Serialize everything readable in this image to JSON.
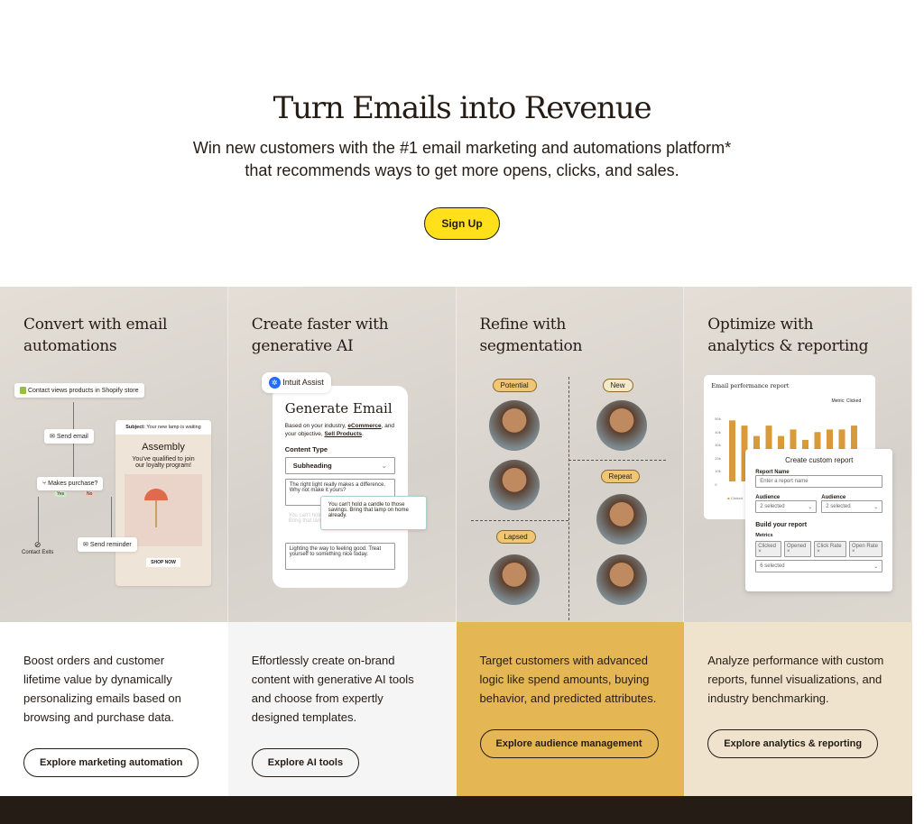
{
  "hero": {
    "title": "Turn Emails into Revenue",
    "subtitle_line1": "Win new customers with the #1 email marketing and automations platform*",
    "subtitle_line2": "that recommends ways to get more opens, clicks, and sales.",
    "cta": "Sign Up"
  },
  "features": [
    {
      "title_line1": "Convert with email",
      "title_line2": "automations",
      "description": "Boost orders and customer lifetime value by dynamically personalizing emails based on browsing and purchase data.",
      "button": "Explore marketing automation",
      "bg": "#ffffff",
      "illustration": {
        "trigger": "Contact views products in Shopify store",
        "send_email": "Send email",
        "decision": "Makes purchase?",
        "yes": "Yes",
        "no": "No",
        "exit": "Contact Exits",
        "reminder": "Send reminder",
        "subject_label": "Subject:",
        "subject": "Your new lamp is waiting",
        "brand": "Assembly",
        "message": "You've qualified to join our loyalty program!",
        "shop": "SHOP NOW"
      }
    },
    {
      "title_line1": "Create faster with",
      "title_line2": "generative AI",
      "description": "Effortlessly create on-brand content with generative AI tools and choose from expertly designed templates.",
      "button": "Explore AI tools",
      "bg": "#f5f5f5",
      "illustration": {
        "badge": "Intuit Assist",
        "heading": "Generate Email",
        "intro_a": "Based on your industry, ",
        "industry": "eCommerce",
        "intro_b": ", and your objective, ",
        "objective": "Sell Products",
        "content_type_label": "Content Type",
        "content_type": "Subheading",
        "option1": "The right light really makes a difference. Why not make it yours?",
        "option2": "You can't hold a candle to those savings. Bring that lamp on home already.",
        "option3": "Lighting the way to feeling good. Treat yourself to something nice today."
      }
    },
    {
      "title_line1": "Refine with",
      "title_line2": "segmentation",
      "description": "Target customers with advanced logic like spend amounts, buying behavior, and predicted attributes.",
      "button": "Explore audience management",
      "bg": "#e5b654",
      "illustration": {
        "segments": [
          "Potential",
          "New",
          "Repeat",
          "Lapsed"
        ]
      }
    },
    {
      "title_line1": "Optimize with",
      "title_line2": "analytics & reporting",
      "description": "Analyze performance with custom reports, funnel visualizations, and industry benchmarking.",
      "button": "Explore analytics & reporting",
      "bg": "#efe3cd",
      "illustration": {
        "report_title": "Email performance report",
        "metric_select": "Metric: Clicked",
        "legend": "Clicked",
        "y_ticks": [
          "50k",
          "40k",
          "30k",
          "20k",
          "10k",
          "0"
        ],
        "bar_values_k": [
          47,
          43,
          35,
          43,
          35,
          40,
          32,
          38,
          40,
          40,
          43
        ],
        "bar_color": "#d99a3a",
        "modal_title": "Create custom report",
        "report_name_label": "Report Name",
        "report_name_placeholder": "Enter a report name",
        "audience_label": "Audience",
        "audience_value": "2 selected",
        "build_label": "Build your report",
        "metrics_label": "Metrics",
        "metrics": [
          "Clicked",
          "Opened",
          "Click Rate",
          "Open Rate"
        ],
        "metrics_selected": "6 selected"
      }
    }
  ]
}
